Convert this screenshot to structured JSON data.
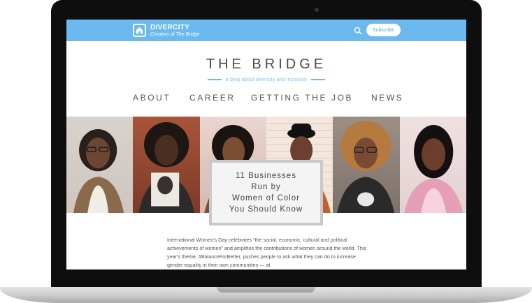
{
  "site": {
    "brand_name": "DIVERCITY",
    "brand_tagline": "Creators of The Bridge",
    "subscribe_label": "Subscribe",
    "search_icon": "search-icon",
    "title": "THE BRIDGE",
    "tagline": "a blog about diversity and inclusion"
  },
  "nav": {
    "items": [
      "ABOUT",
      "CAREER",
      "GETTING THE JOB",
      "NEWS"
    ]
  },
  "hero": {
    "title": "11 Businesses\nRun by\nWomen of Color\nYou Should Know"
  },
  "article": {
    "text": "International Women's Day celebrates “the social, economic, cultural and political achievements of women” and amplifies the contributions of women around the world. This year's theme, #BalanceForBetter, pushes people to ask what they can do to increase gender equality in their own communities — at"
  },
  "colors": {
    "accent": "#6cb9ef",
    "frame": "#0e0e0e"
  }
}
